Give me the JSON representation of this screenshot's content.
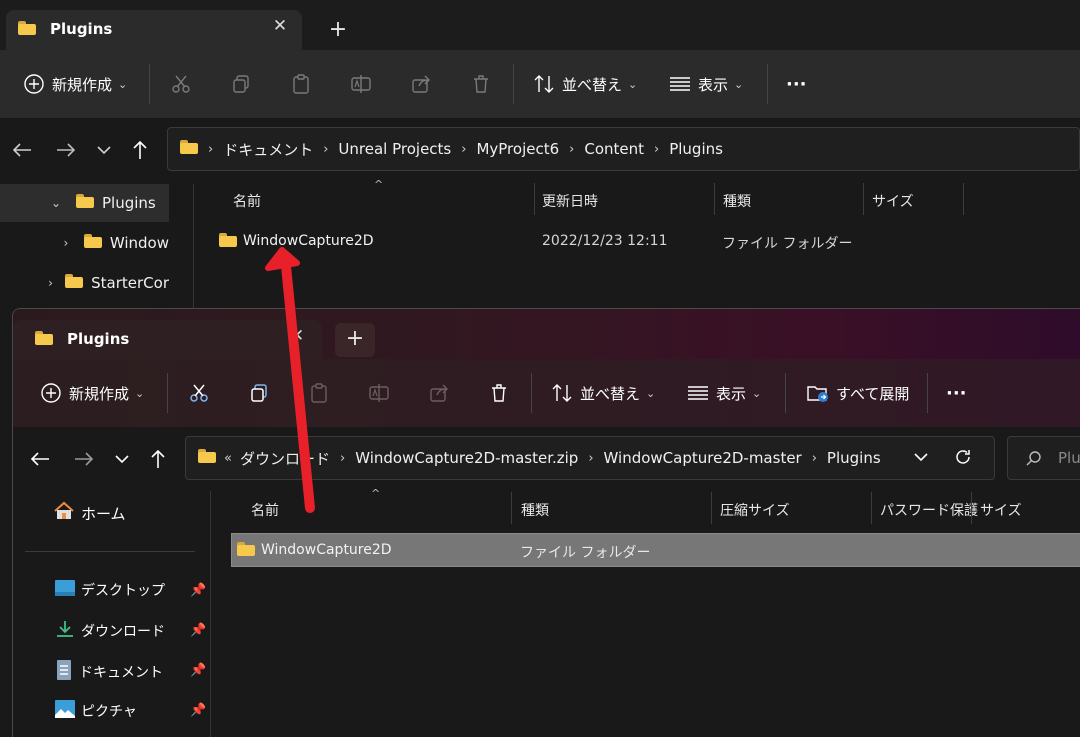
{
  "back_window": {
    "tab_title": "Plugins",
    "toolbar": {
      "new_label": "新規作成",
      "sort_label": "並べ替え",
      "view_label": "表示",
      "more_label": "···"
    },
    "breadcrumb": [
      "ドキュメント",
      "Unreal Projects",
      "MyProject6",
      "Content",
      "Plugins"
    ],
    "nav_tree": [
      {
        "label": "Plugins",
        "expanded": true
      },
      {
        "label": "Window",
        "expanded": false
      },
      {
        "label": "StarterCor",
        "expanded": false
      }
    ],
    "columns": [
      "名前",
      "更新日時",
      "種類",
      "サイズ"
    ],
    "rows": [
      {
        "name": "WindowCapture2D",
        "modified": "2022/12/23 12:11",
        "type": "ファイル フォルダー",
        "size": ""
      }
    ]
  },
  "front_window": {
    "tab_title": "Plugins",
    "toolbar": {
      "new_label": "新規作成",
      "sort_label": "並べ替え",
      "view_label": "表示",
      "extract_label": "すべて展開",
      "more_label": "···"
    },
    "breadcrumb_prefix": "«",
    "breadcrumb": [
      "ダウンロード",
      "WindowCapture2D-master.zip",
      "WindowCapture2D-master",
      "Plugins"
    ],
    "search_placeholder": "Plug",
    "nav": {
      "home_label": "ホーム",
      "quick_access": [
        {
          "label": "デスクトップ",
          "icon": "desktop-icon"
        },
        {
          "label": "ダウンロード",
          "icon": "download-icon"
        },
        {
          "label": "ドキュメント",
          "icon": "document-icon"
        },
        {
          "label": "ピクチャ",
          "icon": "pictures-icon"
        }
      ]
    },
    "columns": [
      "名前",
      "種類",
      "圧縮サイズ",
      "パスワード保護",
      "サイズ"
    ],
    "rows": [
      {
        "name": "WindowCapture2D",
        "type": "ファイル フォルダー",
        "selected": true
      }
    ]
  },
  "colors": {
    "arrow": "#e8202a",
    "folder": "#f6c94d",
    "selection": "#777777"
  }
}
